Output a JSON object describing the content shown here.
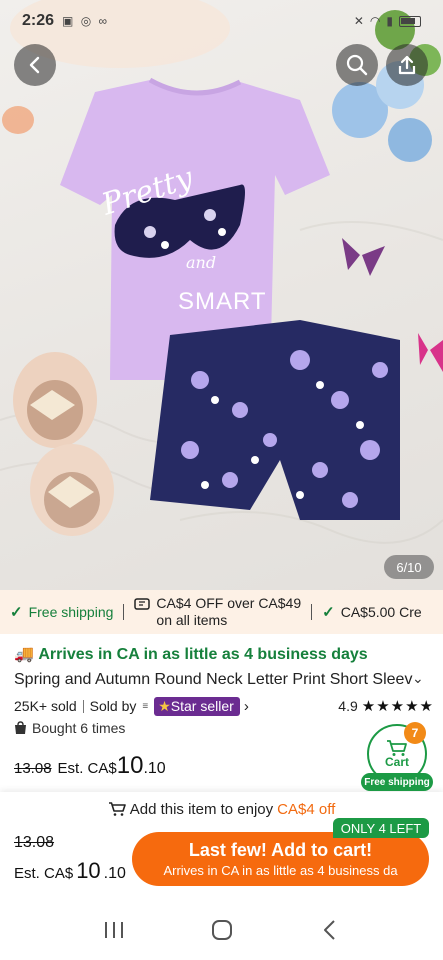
{
  "status_bar": {
    "time": "2:26"
  },
  "gallery": {
    "counter": "6/10"
  },
  "graphic": {
    "print_script": "Pretty",
    "print_and": "and",
    "print_word": "SMART"
  },
  "shipping_strip": {
    "free_shipping": "Free shipping",
    "coupon_line1": "CA$4 OFF over CA$49",
    "coupon_line2": "on all items",
    "more": "CA$5.00 Cre"
  },
  "product": {
    "arrives": "Arrives in CA in as little as 4 business days",
    "title": "Spring and Autumn Round Neck Letter Print Short Sleev",
    "sold": "25K+ sold",
    "sold_by": "Sold by",
    "store_badge": "Star seller",
    "rating": "4.9",
    "stars": "★★★★★",
    "bought": "Bought 6 times",
    "old_price": "13.08",
    "est_label": "Est. CA$",
    "price_main": "10",
    "price_cents": ".10"
  },
  "cart": {
    "label": "Cart",
    "count": "7",
    "free_shipping": "Free shipping"
  },
  "bottom_bar": {
    "enjoy_prefix": "Add this item to enjoy",
    "enjoy_amount": "CA$4 off",
    "old_price": "13.08",
    "est_label": "Est. CA$",
    "price_main": "10",
    "price_cents": ".10",
    "cta_main": "Last few! Add to cart!",
    "cta_sub": "Arrives in CA in as little as 4 business da",
    "only_left": "ONLY 4 LEFT"
  },
  "colors": {
    "accent_orange": "#f66a0e",
    "green": "#1c9a45",
    "star_seller_purple": "#6b2c91",
    "strip_bg": "#fdf1e6"
  }
}
